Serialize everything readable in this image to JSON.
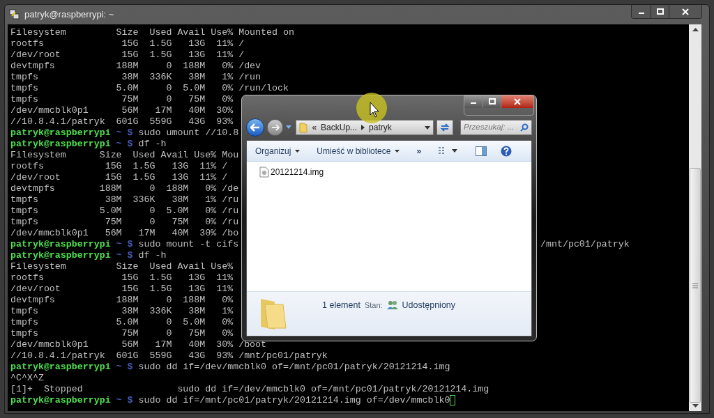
{
  "terminal": {
    "title": "patryk@raspberrypi: ~",
    "lines": [
      {
        "kind": "output",
        "text": "Filesystem         Size  Used Avail Use% Mounted on"
      },
      {
        "kind": "output",
        "text": "rootfs              15G  1.5G   13G  11% /"
      },
      {
        "kind": "output",
        "text": "/dev/root           15G  1.5G   13G  11% /"
      },
      {
        "kind": "output",
        "text": "devtmpfs           188M     0  188M   0% /dev"
      },
      {
        "kind": "output",
        "text": "tmpfs               38M  336K   38M   1% /run"
      },
      {
        "kind": "output",
        "text": "tmpfs              5.0M     0  5.0M   0% /run/lock"
      },
      {
        "kind": "output",
        "text": "tmpfs               75M     0   75M   0%"
      },
      {
        "kind": "output",
        "text": "/dev/mmcblk0p1      56M   17M   40M  30%"
      },
      {
        "kind": "output",
        "text": "//10.8.4.1/patryk  601G  559G   43G  93%"
      },
      {
        "kind": "prompt",
        "user": "patryk@raspberrypi",
        "dir": "~",
        "sign": "$",
        "command": "sudo umount //10.8"
      },
      {
        "kind": "prompt",
        "user": "patryk@raspberrypi",
        "dir": "~",
        "sign": "$",
        "command": "df -h"
      },
      {
        "kind": "output",
        "text": "Filesystem      Size  Used Avail Use% Mou"
      },
      {
        "kind": "output",
        "text": "rootfs           15G  1.5G   13G  11% /"
      },
      {
        "kind": "output",
        "text": "/dev/root        15G  1.5G   13G  11% /"
      },
      {
        "kind": "output",
        "text": "devtmpfs        188M     0  188M   0% /de"
      },
      {
        "kind": "output",
        "text": "tmpfs            38M  336K   38M   1% /ru"
      },
      {
        "kind": "output",
        "text": "tmpfs           5.0M     0  5.0M   0% /ru"
      },
      {
        "kind": "output",
        "text": "tmpfs            75M     0   75M   0% /ru"
      },
      {
        "kind": "output",
        "text": "/dev/mmcblk0p1   56M   17M   40M  30% /bo"
      },
      {
        "kind": "prompt",
        "user": "patryk@raspberrypi",
        "dir": "~",
        "sign": "$",
        "command": "sudo mount -t cifs",
        "tail": "/mnt/pc01/patryk"
      },
      {
        "kind": "prompt",
        "user": "patryk@raspberrypi",
        "dir": "~",
        "sign": "$",
        "command": "df -h"
      },
      {
        "kind": "output",
        "text": "Filesystem         Size  Used Avail Use%"
      },
      {
        "kind": "output",
        "text": "rootfs              15G  1.5G   13G  11%"
      },
      {
        "kind": "output",
        "text": "/dev/root           15G  1.5G   13G  11%"
      },
      {
        "kind": "output",
        "text": "devtmpfs           188M     0  188M   0%"
      },
      {
        "kind": "output",
        "text": "tmpfs               38M  336K   38M   1%"
      },
      {
        "kind": "output",
        "text": "tmpfs              5.0M     0  5.0M   0%"
      },
      {
        "kind": "output",
        "text": "tmpfs               75M     0   75M   0%"
      },
      {
        "kind": "output",
        "text": "/dev/mmcblk0p1      56M   17M   40M  30% /boot"
      },
      {
        "kind": "output",
        "text": "//10.8.4.1/patryk  601G  559G   43G  93% /mnt/pc01/patryk"
      },
      {
        "kind": "prompt",
        "user": "patryk@raspberrypi",
        "dir": "~",
        "sign": "$",
        "command": "sudo dd if=/dev/mmcblk0 of=/mnt/pc01/patryk/20121214.img"
      },
      {
        "kind": "output",
        "text": "^C^X^Z"
      },
      {
        "kind": "output",
        "text": "[1]+  Stopped                 sudo dd if=/dev/mmcblk0 of=/mnt/pc01/patryk/20121214.img"
      },
      {
        "kind": "prompt",
        "user": "patryk@raspberrypi",
        "dir": "~",
        "sign": "$",
        "command": "sudo dd if=/mnt/pc01/patryk/20121214.img of=/dev/mmcblk0",
        "cursor": true
      }
    ]
  },
  "explorer": {
    "address": {
      "overflow": "«",
      "crumbs": [
        "BackUp...",
        "patryk"
      ]
    },
    "search": {
      "placeholder": "Przeszukaj: ..."
    },
    "toolbar": [
      {
        "kind": "menu",
        "label": "Organizuj"
      },
      {
        "kind": "menu",
        "label": "Umieść w bibliotece"
      },
      {
        "kind": "overflow",
        "label": "»"
      }
    ],
    "files": [
      {
        "name": "20121214.img"
      }
    ],
    "details": {
      "count": "1 element",
      "state_label": "Stan:",
      "state": "Udostępniony"
    }
  }
}
